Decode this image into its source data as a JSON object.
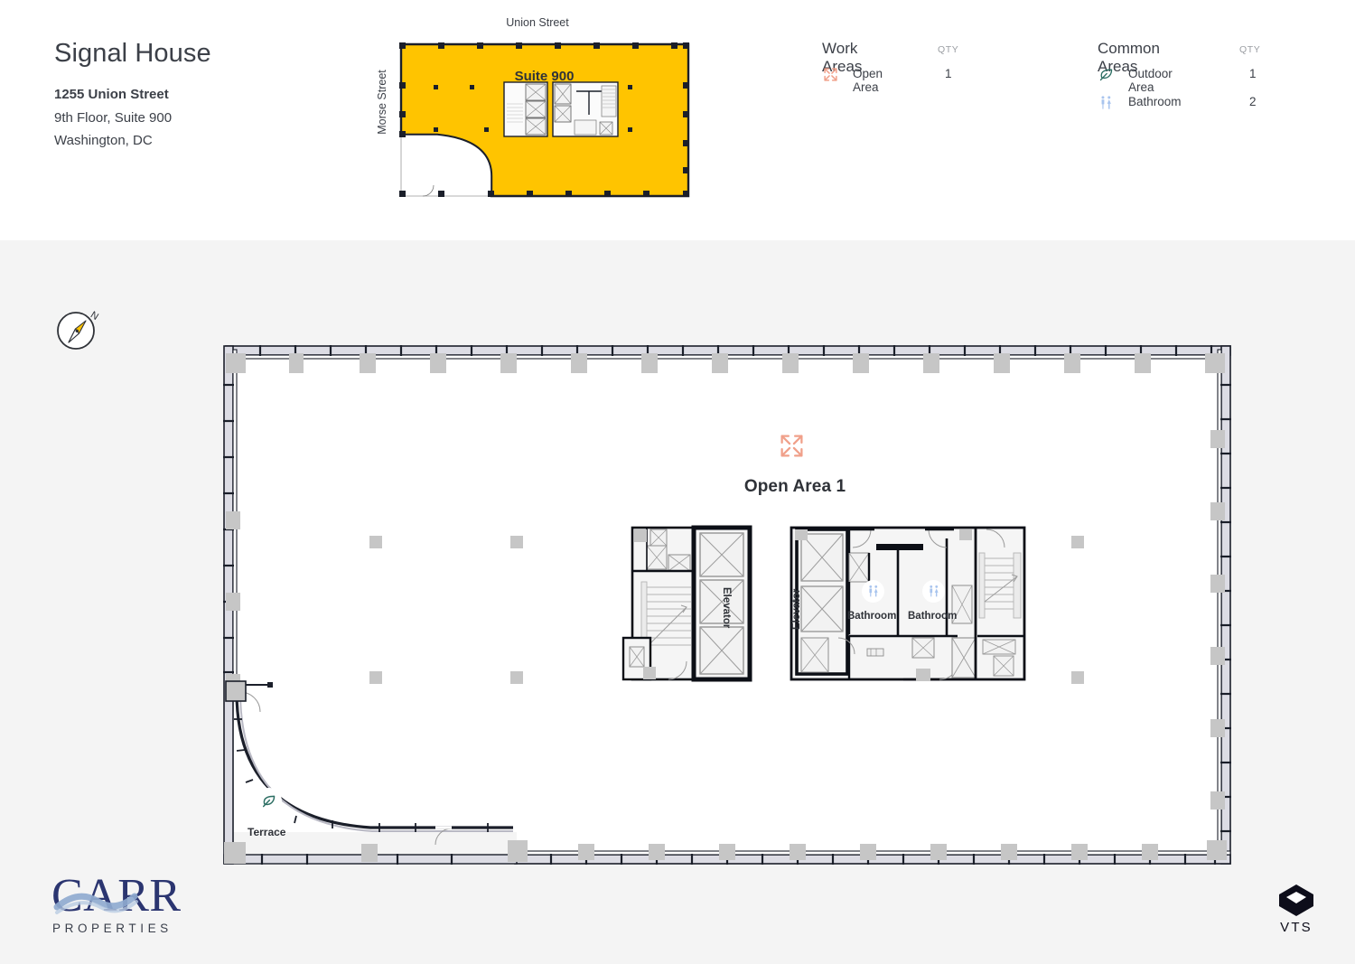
{
  "header": {
    "building_name": "Signal House",
    "address_line1": "1255 Union Street",
    "address_line2": "9th Floor, Suite 900",
    "address_line3": "Washington, DC"
  },
  "keyplan": {
    "street_top": "Union Street",
    "street_left": "Morse Street",
    "suite_label": "Suite 900",
    "highlight_color": "#FFC400"
  },
  "legend": {
    "work_areas": {
      "title": "Work Areas",
      "qty_header": "QTY",
      "items": [
        {
          "icon": "expand-arrows-icon",
          "label": "Open Area",
          "qty": "1",
          "color": "#F0A08A"
        }
      ]
    },
    "common_areas": {
      "title": "Common Areas",
      "qty_header": "QTY",
      "items": [
        {
          "icon": "leaf-icon",
          "label": "Outdoor Area",
          "qty": "1",
          "color": "#2C6E63"
        },
        {
          "icon": "restroom-icon",
          "label": "Bathroom",
          "qty": "2",
          "color": "#A8C4EE"
        }
      ]
    }
  },
  "compass": {
    "north_label": "N",
    "needle_color": "#FFC400"
  },
  "plan": {
    "open_area_label": "Open Area 1",
    "open_area_icon": "expand-arrows-icon",
    "terrace_label": "Terrace",
    "terrace_icon": "leaf-icon",
    "bathroom_1_label": "Bathroom",
    "bathroom_2_label": "Bathroom",
    "bathroom_icon": "restroom-icon",
    "elevator_label_1": "Elevator",
    "elevator_label_2": "Elevator"
  },
  "footer": {
    "carr_name": "CARR",
    "carr_subtitle": "P R O P E R T I E S",
    "vts_name": "VTS"
  },
  "colors": {
    "page_bg": "#FFFFFF",
    "plan_bg": "#F4F4F4",
    "wall": "#1B1F2A",
    "column": "#C4C4C4",
    "accent_yellow": "#FFC400",
    "accent_salmon": "#F0A08A",
    "accent_green": "#2C6E63",
    "accent_blue": "#A8C4EE",
    "text": "#3C4048",
    "carr_navy": "#2B3570",
    "carr_wave": "#8FAACF"
  }
}
